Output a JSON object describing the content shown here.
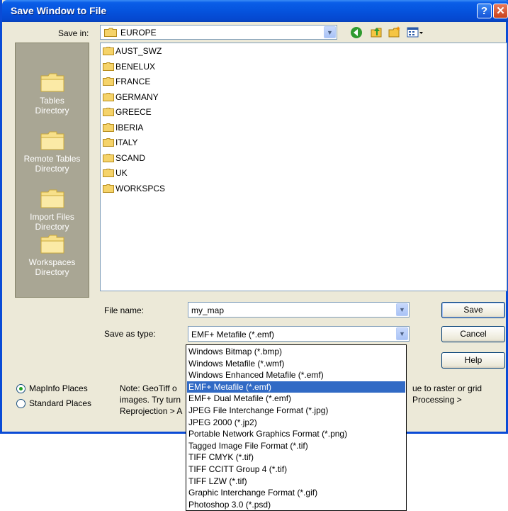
{
  "window": {
    "title": "Save Window to File"
  },
  "save_in": {
    "label": "Save in:",
    "value": "EUROPE"
  },
  "places": [
    {
      "label1": "Tables",
      "label2": "Directory"
    },
    {
      "label1": "Remote Tables",
      "label2": "Directory"
    },
    {
      "label1": "Import Files",
      "label2": "Directory"
    },
    {
      "label1": "Workspaces",
      "label2": "Directory"
    }
  ],
  "folders": [
    "AUST_SWZ",
    "BENELUX",
    "FRANCE",
    "GERMANY",
    "GREECE",
    "IBERIA",
    "ITALY",
    "SCAND",
    "UK",
    "WORKSPCS"
  ],
  "file_name": {
    "label": "File name:",
    "value": "my_map"
  },
  "save_as_type": {
    "label": "Save as type:",
    "value": "EMF+ Metafile (*.emf)"
  },
  "buttons": {
    "save": "Save",
    "cancel": "Cancel",
    "help": "Help"
  },
  "radios": {
    "mapinfo": "MapInfo Places",
    "standard": "Standard Places",
    "selected": "mapinfo"
  },
  "note": {
    "line1_start": "Note: GeoTiff o",
    "line1_end": "ue to raster or grid",
    "line2_start": "images. Try turn",
    "line2_end": "Processing >",
    "line3_start": "Reprojection > A"
  },
  "type_options": [
    "Windows Bitmap (*.bmp)",
    "Windows Metafile (*.wmf)",
    "Windows Enhanced Metafile (*.emf)",
    "EMF+ Metafile (*.emf)",
    "EMF+ Dual Metafile (*.emf)",
    "JPEG File Interchange Format (*.jpg)",
    "JPEG 2000 (*.jp2)",
    "Portable Network Graphics Format (*.png)",
    "Tagged Image File Format (*.tif)",
    "TIFF CMYK (*.tif)",
    "TIFF CCITT Group 4 (*.tif)",
    "TIFF LZW (*.tif)",
    "Graphic Interchange Format (*.gif)",
    "Photoshop 3.0 (*.psd)"
  ],
  "selected_type_index": 3,
  "colors": {
    "title_blue": "#0553dd",
    "selection": "#316ac5",
    "dialog_bg": "#ece9d8",
    "places_bg": "#a9a694"
  }
}
